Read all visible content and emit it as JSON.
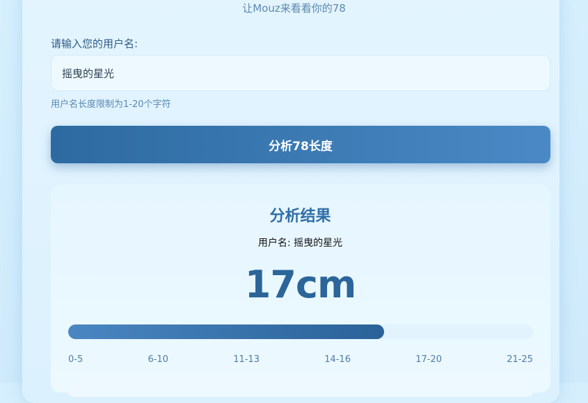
{
  "header": {
    "subtitle": "让Mouz来看看你的78"
  },
  "form": {
    "label": "请输入您的用户名:",
    "username_value": "摇曳的星光",
    "hint": "用户名长度限制为1-20个字符",
    "analyze_button_label": "分析78长度"
  },
  "result": {
    "title": "分析结果",
    "username_line": "用户名: 摇曳的星光",
    "value": "17cm",
    "progress_fraction": 0.68,
    "scale_labels": [
      "0-5",
      "6-10",
      "11-13",
      "14-16",
      "17-20",
      "21-25"
    ]
  },
  "colors": {
    "accent": "#2f6ea6",
    "button_start": "#2d6aa1",
    "button_end": "#4a89c5"
  }
}
